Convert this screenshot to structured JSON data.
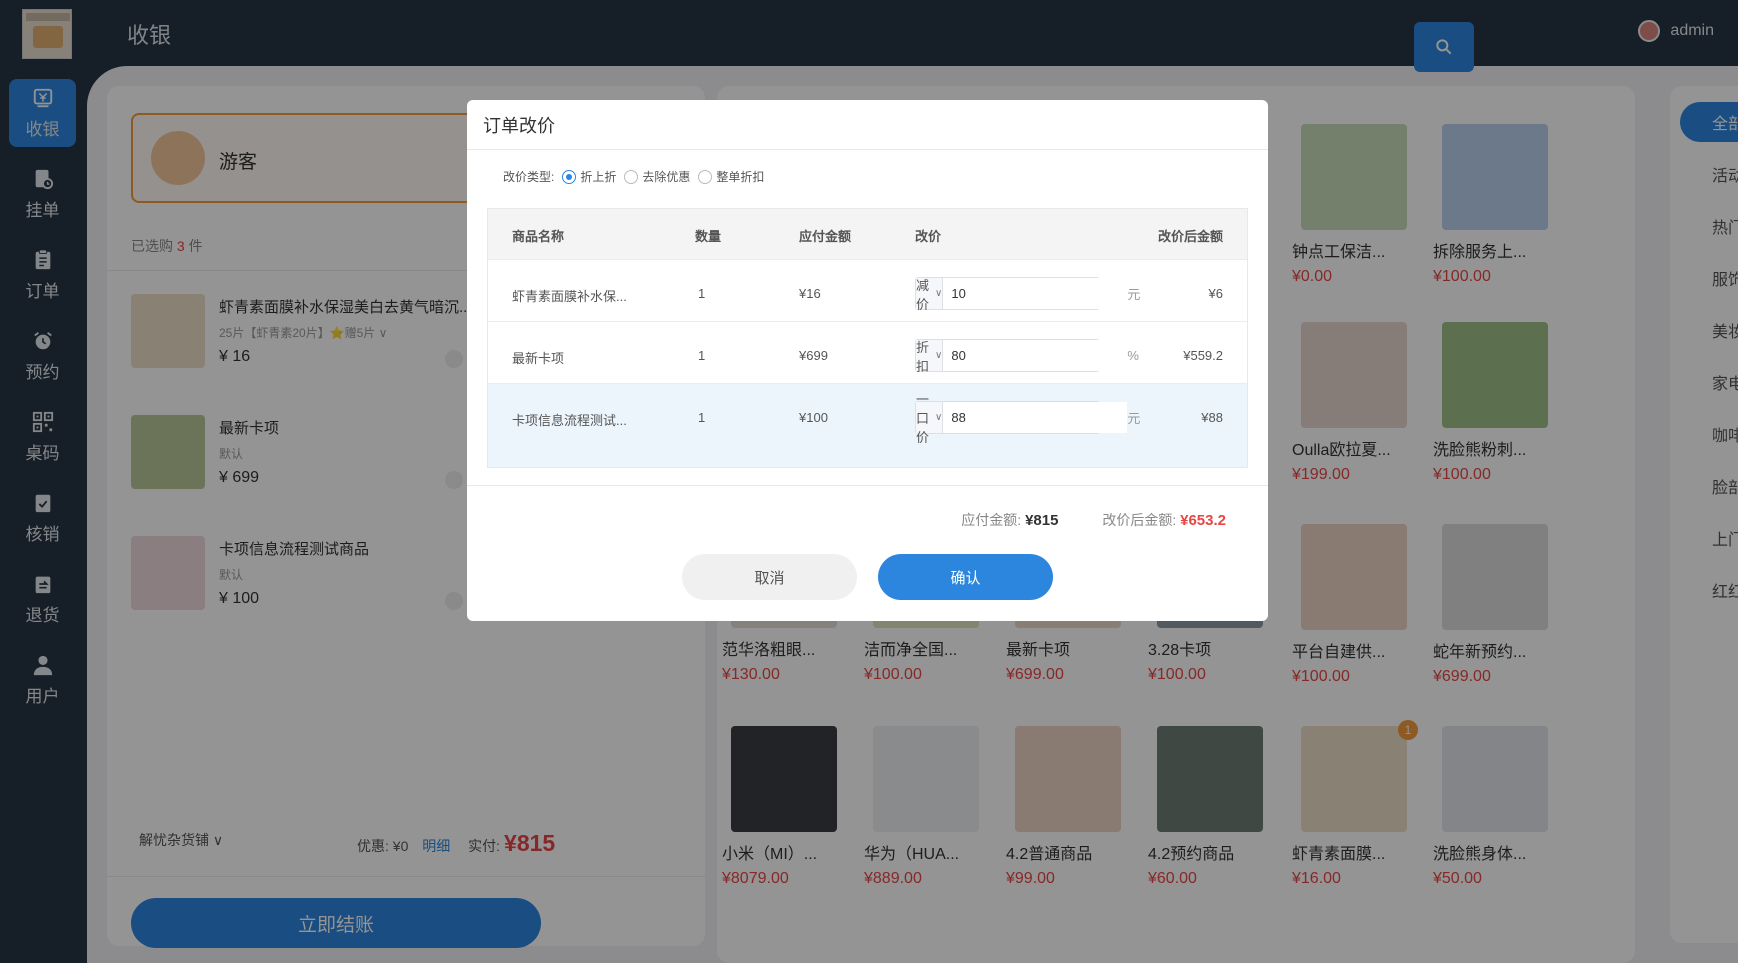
{
  "header": {
    "title": "收银",
    "username": "admin"
  },
  "sidebar": {
    "items": [
      {
        "label": "收银",
        "icon": "yen-icon",
        "active": true
      },
      {
        "label": "挂单",
        "icon": "hang-order-icon"
      },
      {
        "label": "订单",
        "icon": "order-icon"
      },
      {
        "label": "预约",
        "icon": "alarm-clock-icon"
      },
      {
        "label": "桌码",
        "icon": "qrcode-icon"
      },
      {
        "label": "核销",
        "icon": "verify-icon"
      },
      {
        "label": "退货",
        "icon": "return-icon"
      },
      {
        "label": "用户",
        "icon": "user-icon"
      }
    ]
  },
  "cart": {
    "customer": "游客",
    "selected_prefix": "已选购",
    "selected_count": "3",
    "selected_suffix": "件",
    "items": [
      {
        "name": "虾青素面膜补水保湿美白去黄气暗沉...",
        "spec": "25片【虾青素20片】⭐赠5片 ∨",
        "price": "¥ 16"
      },
      {
        "name": "最新卡项",
        "spec": "默认",
        "price": "¥ 699"
      },
      {
        "name": "卡项信息流程测试商品",
        "spec": "默认",
        "price": "¥ 100"
      }
    ],
    "shop": "解忧杂货铺",
    "discount_label": "优惠: ¥0",
    "detail_link": "明细",
    "paid_label": "实付:",
    "paid_amount": "¥815",
    "checkout_label": "立即结账"
  },
  "products": [
    {
      "name": "钟点工保洁...",
      "price": "¥0.00"
    },
    {
      "name": "拆除服务上...",
      "price": "¥100.00"
    },
    {
      "name": "Oulla欧拉夏...",
      "price": "¥199.00"
    },
    {
      "name": "洗脸熊粉刺...",
      "price": "¥100.00"
    },
    {
      "name": "范华洛粗眼...",
      "price": "¥130.00"
    },
    {
      "name": "洁而净全国...",
      "price": "¥100.00"
    },
    {
      "name": "最新卡项",
      "price": "¥699.00"
    },
    {
      "name": "3.28卡项",
      "price": "¥100.00"
    },
    {
      "name": "平台自建供...",
      "price": "¥100.00"
    },
    {
      "name": "蛇年新预约...",
      "price": "¥699.00"
    },
    {
      "name": "小米（MI）...",
      "price": "¥8079.00"
    },
    {
      "name": "华为（HUA...",
      "price": "¥889.00"
    },
    {
      "name": "4.2普通商品",
      "price": "¥99.00"
    },
    {
      "name": "4.2预约商品",
      "price": "¥60.00"
    },
    {
      "name": "虾青素面膜...",
      "price": "¥16.00",
      "badge": "1"
    },
    {
      "name": "洗脸熊身体...",
      "price": "¥50.00"
    }
  ],
  "categories": [
    "全部商品",
    "活动商品",
    "热门推荐",
    "服饰分类",
    "美妆护肤",
    "家电电器",
    "咖啡次卡",
    "脸部美容",
    "上门服务",
    "红红火火"
  ],
  "dialog": {
    "title": "订单改价",
    "type_label": "改价类型:",
    "types": [
      "折上折",
      "去除优惠",
      "整单折扣"
    ],
    "columns": [
      "商品名称",
      "数量",
      "应付金额",
      "改价",
      "改价后金额"
    ],
    "rows": [
      {
        "name": "虾青素面膜补水保...",
        "qty": "1",
        "due": "¥16",
        "mode": "减价",
        "value": "10",
        "unit": "元",
        "after": "¥6"
      },
      {
        "name": "最新卡项",
        "qty": "1",
        "due": "¥699",
        "mode": "折扣",
        "value": "80",
        "unit": "%",
        "after": "¥559.2"
      },
      {
        "name": "卡项信息流程测试...",
        "qty": "1",
        "due": "¥100",
        "mode": "一口价",
        "value": "88",
        "unit": "元",
        "after": "¥88"
      }
    ],
    "due_label": "应付金额:",
    "due_total": "¥815",
    "after_label": "改价后金额:",
    "after_total": "¥653.2",
    "cancel_label": "取消",
    "confirm_label": "确认"
  }
}
